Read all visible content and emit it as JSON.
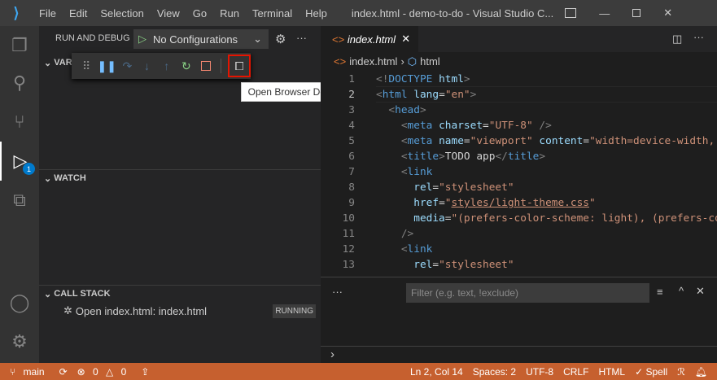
{
  "title_bar": {
    "menus": [
      "File",
      "Edit",
      "Selection",
      "View",
      "Go",
      "Run",
      "Terminal",
      "Help"
    ],
    "window_title": "index.html - demo-to-do - Visual Studio C..."
  },
  "sidebar": {
    "title": "RUN AND DEBUG",
    "config": "No Configurations",
    "variables": "VAR",
    "watch": "WATCH",
    "call_stack": "CALL STACK",
    "stack_item": "Open index.html: index.html",
    "stack_status": "RUNNING",
    "debug_badge": "1"
  },
  "tooltip": "Open Browser Devtools",
  "editor": {
    "tab": "index.html",
    "breadcrumb_file": "index.html",
    "breadcrumb_symbol": "html",
    "lines": [
      [
        [
          "p",
          "<!"
        ],
        [
          "t",
          "DOCTYPE"
        ],
        [
          "x",
          " "
        ],
        [
          "a",
          "html"
        ],
        [
          "p",
          ">"
        ]
      ],
      [
        [
          "p",
          "<"
        ],
        [
          "t",
          "html"
        ],
        [
          "x",
          " "
        ],
        [
          "a",
          "lang"
        ],
        [
          "x",
          "="
        ],
        [
          "s",
          "\"en\""
        ],
        [
          "p",
          ">"
        ]
      ],
      [
        [
          "x",
          "  "
        ],
        [
          "p",
          "<"
        ],
        [
          "t",
          "head"
        ],
        [
          "p",
          ">"
        ]
      ],
      [
        [
          "x",
          "    "
        ],
        [
          "p",
          "<"
        ],
        [
          "t",
          "meta"
        ],
        [
          "x",
          " "
        ],
        [
          "a",
          "charset"
        ],
        [
          "x",
          "="
        ],
        [
          "s",
          "\"UTF-8\""
        ],
        [
          "x",
          " "
        ],
        [
          "p",
          "/>"
        ]
      ],
      [
        [
          "x",
          "    "
        ],
        [
          "p",
          "<"
        ],
        [
          "t",
          "meta"
        ],
        [
          "x",
          " "
        ],
        [
          "a",
          "name"
        ],
        [
          "x",
          "="
        ],
        [
          "s",
          "\"viewport\""
        ],
        [
          "x",
          " "
        ],
        [
          "a",
          "content"
        ],
        [
          "x",
          "="
        ],
        [
          "s",
          "\"width=device-width, "
        ]
      ],
      [
        [
          "x",
          "    "
        ],
        [
          "p",
          "<"
        ],
        [
          "t",
          "title"
        ],
        [
          "p",
          ">"
        ],
        [
          "x",
          "TODO app"
        ],
        [
          "p",
          "</"
        ],
        [
          "t",
          "title"
        ],
        [
          "p",
          ">"
        ]
      ],
      [
        [
          "x",
          "    "
        ],
        [
          "p",
          "<"
        ],
        [
          "t",
          "link"
        ]
      ],
      [
        [
          "x",
          "      "
        ],
        [
          "a",
          "rel"
        ],
        [
          "x",
          "="
        ],
        [
          "s",
          "\"stylesheet\""
        ]
      ],
      [
        [
          "x",
          "      "
        ],
        [
          "a",
          "href"
        ],
        [
          "x",
          "="
        ],
        [
          "s",
          "\""
        ],
        [
          "s u",
          "styles/light-theme.css"
        ],
        [
          "s",
          "\""
        ]
      ],
      [
        [
          "x",
          "      "
        ],
        [
          "a",
          "media"
        ],
        [
          "x",
          "="
        ],
        [
          "s",
          "\"(prefers-color-scheme: light), (prefers-co"
        ]
      ],
      [
        [
          "x",
          "    "
        ],
        [
          "p",
          "/>"
        ]
      ],
      [
        [
          "x",
          "    "
        ],
        [
          "p",
          "<"
        ],
        [
          "t",
          "link"
        ]
      ],
      [
        [
          "x",
          "      "
        ],
        [
          "a",
          "rel"
        ],
        [
          "x",
          "="
        ],
        [
          "s",
          "\"stylesheet\""
        ]
      ]
    ]
  },
  "panel": {
    "filter_placeholder": "Filter (e.g. text, !exclude)",
    "more": "···",
    "prompt": "›"
  },
  "status_bar": {
    "branch": "main",
    "errors": "0",
    "warnings": "0",
    "position": "Ln 2, Col 14",
    "spaces": "Spaces: 2",
    "encoding": "UTF-8",
    "eol": "CRLF",
    "language": "HTML",
    "spell": "✓ Spell"
  },
  "colors": {
    "status_bar": "#c6602f",
    "accent": "#007acc",
    "highlight_box": "#e51400"
  }
}
